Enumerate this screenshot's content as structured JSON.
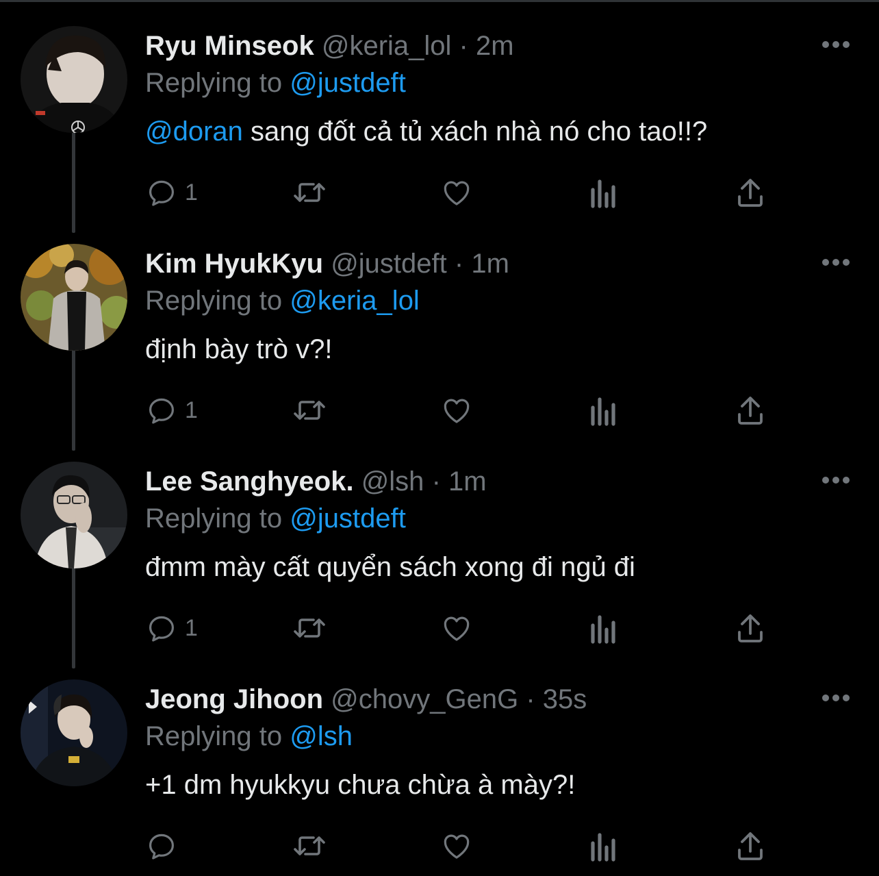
{
  "colors": {
    "background": "#000000",
    "text": "#e7e9ea",
    "muted": "#71767b",
    "link": "#1d9bf0",
    "thread_line": "#333639"
  },
  "reply_prefix": "Replying to",
  "separator": "·",
  "tweets": [
    {
      "name": "Ryu Minseok",
      "handle": "@keria_lol",
      "time": "2m",
      "replying_to": "@justdeft",
      "mention": "@doran",
      "text": " sang đốt cả tủ xách nhà nó cho tao!!?",
      "reply_count": "1"
    },
    {
      "name": "Kim HyukKyu",
      "handle": "@justdeft",
      "time": "1m",
      "replying_to": "@keria_lol",
      "mention": "",
      "text": "định bày trò v?!",
      "reply_count": "1"
    },
    {
      "name": "Lee Sanghyeok.",
      "handle": "@lsh",
      "time": "1m",
      "replying_to": "@justdeft",
      "mention": "",
      "text": "đmm mày cất quyển sách xong đi ngủ đi",
      "reply_count": "1"
    },
    {
      "name": "Jeong Jihoon",
      "handle": "@chovy_GenG",
      "time": "35s",
      "replying_to": "@lsh",
      "mention": "",
      "text": "+1 dm hyukkyu chưa chừa à mày?!",
      "reply_count": ""
    }
  ]
}
